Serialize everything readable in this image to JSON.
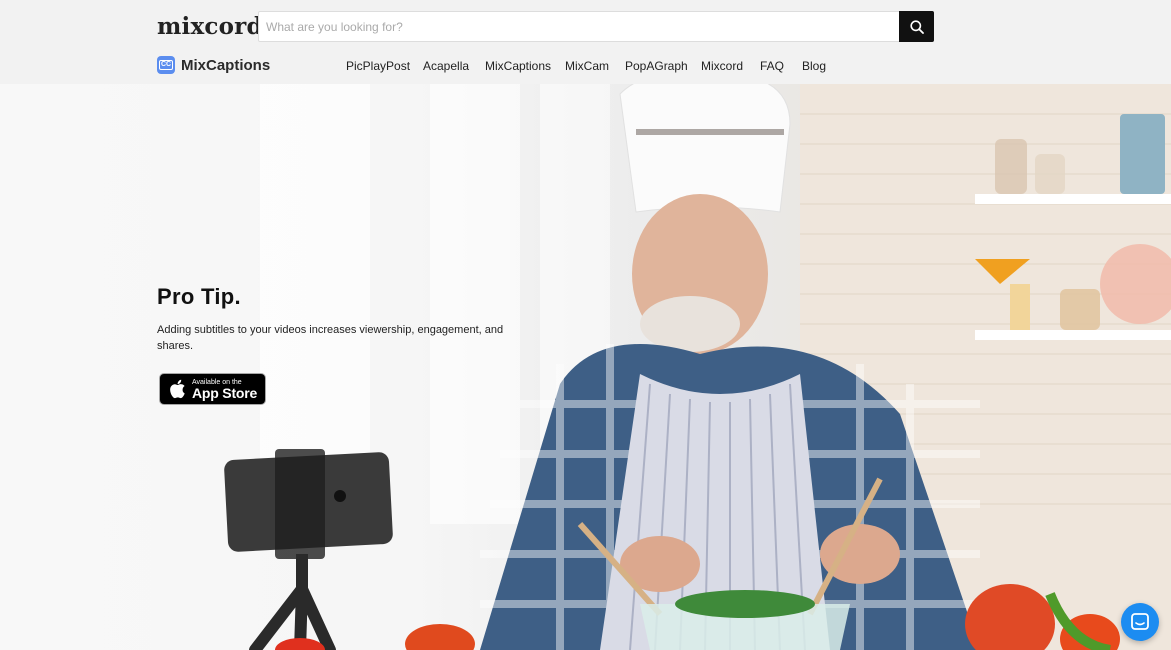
{
  "header": {
    "logo_text": "mixcord",
    "search": {
      "placeholder": "What are you looking for?",
      "value": ""
    },
    "product_name": "MixCaptions",
    "nav": [
      {
        "label": "PicPlayPost"
      },
      {
        "label": "Acapella"
      },
      {
        "label": "MixCaptions"
      },
      {
        "label": "MixCam"
      },
      {
        "label": "PopAGraph"
      },
      {
        "label": "Mixcord"
      },
      {
        "label": "FAQ"
      },
      {
        "label": "Blog"
      }
    ]
  },
  "hero": {
    "title": "Pro Tip.",
    "body": "Adding subtitles to your videos increases viewership, engagement, and shares.",
    "app_store": {
      "small": "Available on the",
      "big": "App Store"
    }
  },
  "colors": {
    "accent": "#1c8cf1",
    "product_icon": "#5b8def",
    "search_button": "#111111"
  },
  "icons": [
    "search-icon",
    "captions-icon",
    "apple-icon",
    "chat-icon"
  ]
}
